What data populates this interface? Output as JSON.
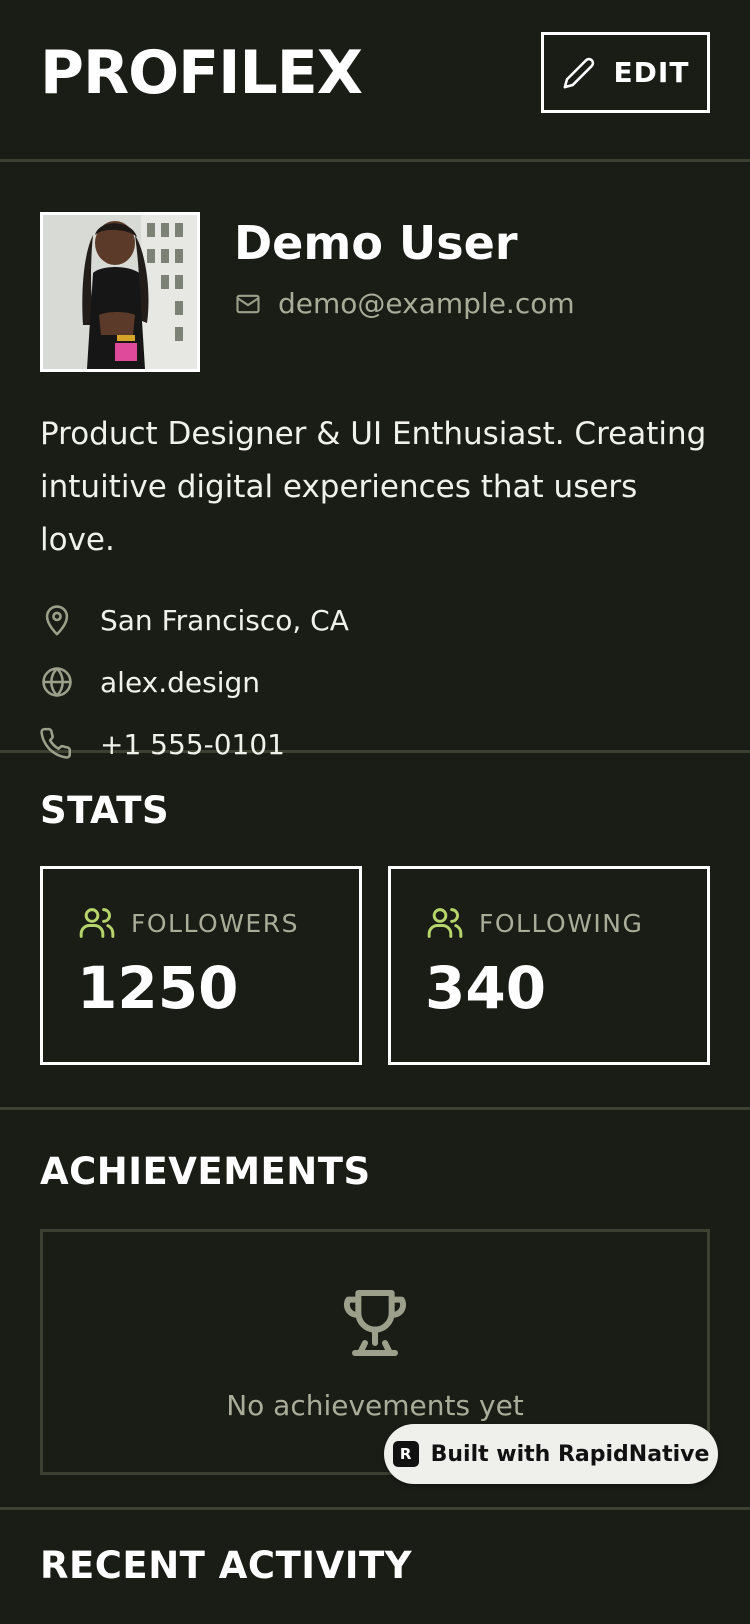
{
  "header": {
    "title": "PROFILEX",
    "edit_label": "EDIT"
  },
  "profile": {
    "name": "Demo User",
    "email": "demo@example.com",
    "bio": "Product Designer & UI Enthusiast. Creating intuitive digital experiences that users love.",
    "location": "San Francisco, CA",
    "website": "alex.design",
    "phone": "+1 555-0101"
  },
  "stats": {
    "title": "STATS",
    "followers_label": "FOLLOWERS",
    "followers_value": "1250",
    "following_label": "FOLLOWING",
    "following_value": "340"
  },
  "achievements": {
    "title": "ACHIEVEMENTS",
    "empty_text": "No achievements yet"
  },
  "recent": {
    "title": "RECENT ACTIVITY"
  },
  "badge": {
    "logo_letter": "R",
    "text": "Built with RapidNative"
  },
  "icons": {
    "edit": "pencil-icon",
    "email": "mail-icon",
    "location": "map-pin-icon",
    "website": "globe-icon",
    "phone": "phone-icon",
    "followers": "users-icon",
    "following": "users-icon",
    "achievements": "trophy-icon"
  },
  "colors": {
    "background": "#1a1c16",
    "divider": "#3d4132",
    "muted_text": "#a9ac98",
    "accent": "#b7d36b",
    "icon_muted": "#9ca08a"
  }
}
